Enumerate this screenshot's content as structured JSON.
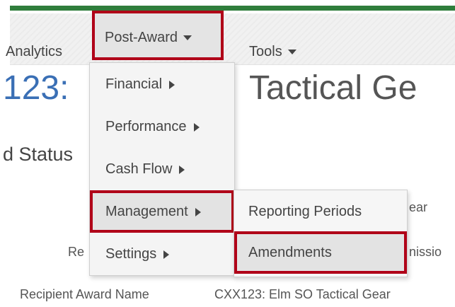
{
  "nav": {
    "analytics": "Analytics",
    "post_award": "Post-Award",
    "tools": "Tools"
  },
  "page": {
    "title_left": "123:",
    "title_right": "Tactical Ge",
    "section": "d Status",
    "fields": {
      "row1_value": "ear",
      "row2_label": "Re",
      "row2_value": "nissio",
      "row3_label": "Recipient Award Name",
      "row3_value": "CXX123: Elm SO Tactical Gear"
    }
  },
  "dropdown": {
    "items": [
      {
        "label": "Financial"
      },
      {
        "label": "Performance"
      },
      {
        "label": "Cash Flow"
      },
      {
        "label": "Management"
      },
      {
        "label": "Settings"
      }
    ]
  },
  "submenu": {
    "items": [
      {
        "label": "Reporting Periods"
      },
      {
        "label": "Amendments"
      }
    ]
  },
  "colors": {
    "accent_green": "#2f7d3b",
    "highlight_red": "#b00018",
    "title_blue": "#3a6fb5"
  }
}
